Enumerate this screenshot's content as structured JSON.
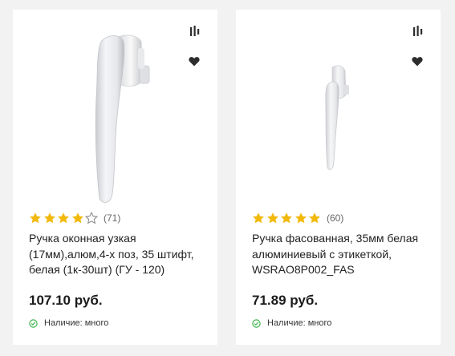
{
  "colors": {
    "star_filled": "#f2b90c",
    "star_empty": "#8e8e8e",
    "in_stock": "#3cb54a",
    "icon": "#2d2d2d",
    "background": "#f2f2f2",
    "card": "#ffffff"
  },
  "products": [
    {
      "rating": 4,
      "rating_max": 5,
      "reviews": "(71)",
      "title": "Ручка оконная узкая (17мм),алюм,4-х поз, 35 штифт, белая (1к-30шт) (ГУ - 120)",
      "price": "107.10 руб.",
      "availability": "Наличие: много",
      "icons": [
        "compare-icon",
        "heart-icon",
        "check-circle-icon"
      ]
    },
    {
      "rating": 5,
      "rating_max": 5,
      "reviews": "(60)",
      "title": "Ручка фасованная, 35мм белая алюминиевый с этикеткой, WSRAO8P002_FAS",
      "price": "71.89 руб.",
      "availability": "Наличие: много",
      "icons": [
        "compare-icon",
        "heart-icon",
        "check-circle-icon"
      ]
    }
  ]
}
